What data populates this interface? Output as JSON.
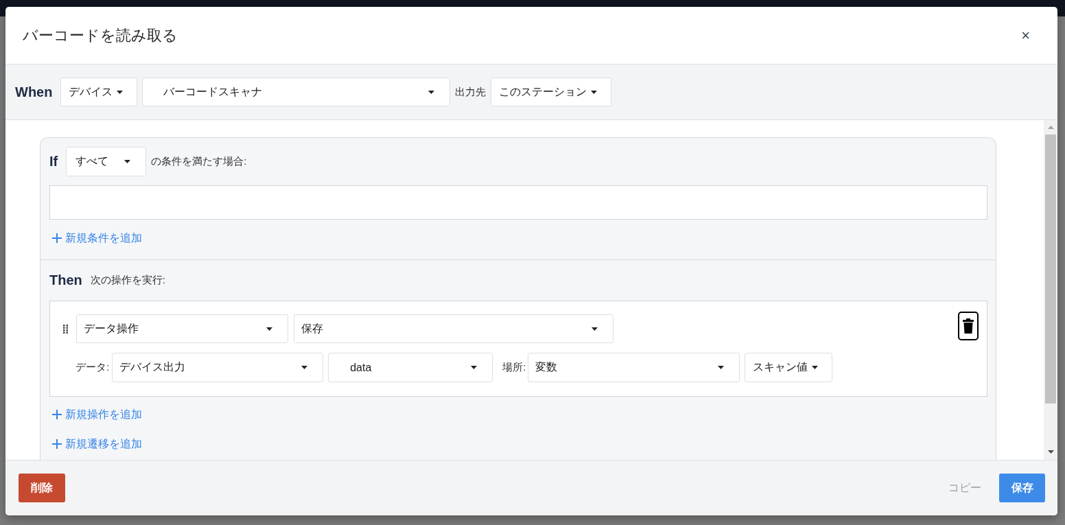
{
  "dialog": {
    "title": "バーコードを読み取る",
    "close": "×"
  },
  "when": {
    "label": "When",
    "source": "デバイス",
    "device": "バーコードスキャナ",
    "output_label": "出力先",
    "output": "このステーション"
  },
  "if": {
    "label": "If",
    "match": "すべて",
    "match_text": "の条件を満たす場合:",
    "add_condition": "新規条件を追加"
  },
  "then": {
    "label": "Then",
    "text": "次の操作を実行:",
    "actions": [
      {
        "category": "データ操作",
        "operation": "保存",
        "data_label": "データ:",
        "data_source": "デバイス出力",
        "data_field": "data",
        "place_label": "場所:",
        "place_type": "変数",
        "place_name": "スキャン値"
      }
    ],
    "add_action": "新規操作を追加",
    "add_transition": "新規遷移を追加"
  },
  "footer": {
    "delete": "削除",
    "copy": {
      "label": "コピー",
      "disabled": true
    },
    "save": "保存"
  }
}
